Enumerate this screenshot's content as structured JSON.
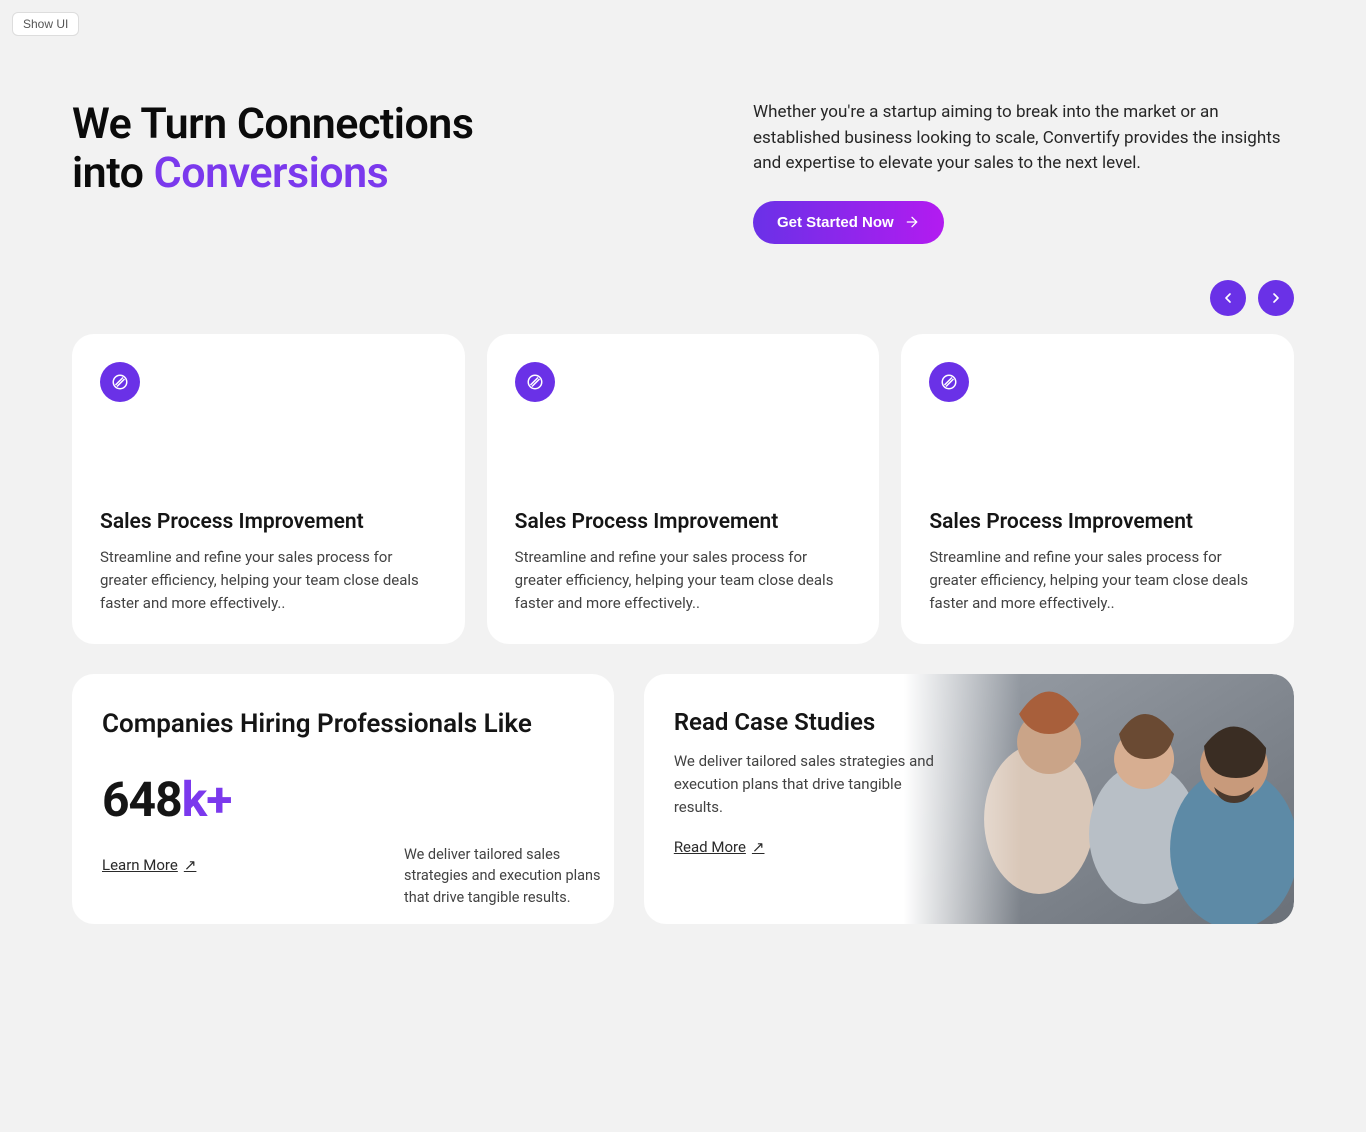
{
  "topButton": "Show UI",
  "hero": {
    "title_line1": "We Turn Connections",
    "title_line2_pre": "into ",
    "title_line2_accent": "Conversions",
    "description": "Whether you're a startup aiming to break into the market or an established business looking to scale, Convertify provides the insights and expertise to elevate your sales to the next level.",
    "cta": "Get Started Now"
  },
  "nav": {
    "prev": "previous",
    "next": "next"
  },
  "cards": [
    {
      "title": "Sales Process Improvement",
      "desc": "Streamline and refine your sales process for greater efficiency, helping your team close deals faster and more effectively.."
    },
    {
      "title": "Sales Process Improvement",
      "desc": "Streamline and refine your sales process for greater efficiency, helping your team close deals faster and more effectively.."
    },
    {
      "title": "Sales Process Improvement",
      "desc": "Streamline and refine your sales process for greater efficiency, helping your team close deals faster and more effectively.."
    }
  ],
  "stats": {
    "title": "Companies Hiring Professionals Like",
    "number": "648",
    "suffix": "k+",
    "link": "Learn More",
    "desc": "We deliver tailored sales strategies and execution plans that drive tangible results."
  },
  "case": {
    "title": "Read Case Studies",
    "desc": "We deliver tailored sales strategies and execution plans that drive tangible results.",
    "link": "Read More"
  }
}
